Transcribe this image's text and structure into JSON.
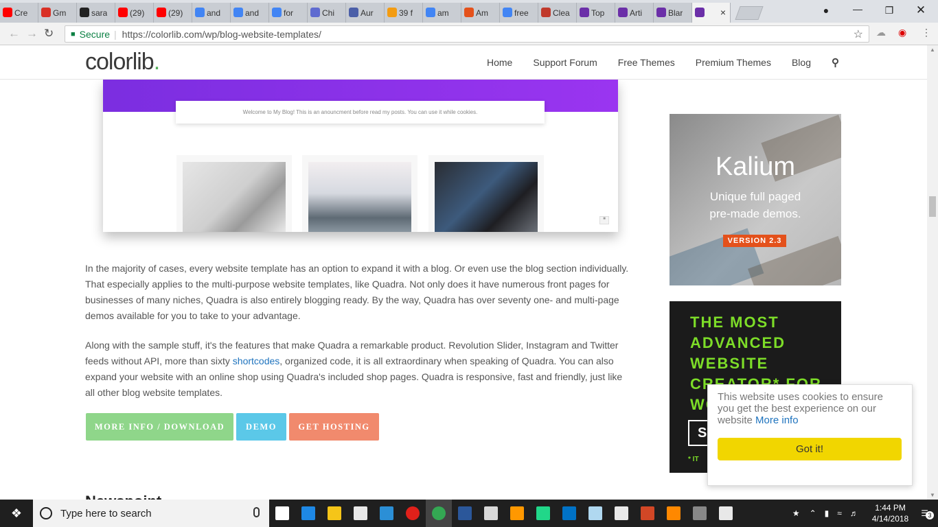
{
  "browser": {
    "tabs": [
      {
        "label": "Cre",
        "icon": "youtube-icon",
        "color": "#ff0000"
      },
      {
        "label": "Gm",
        "icon": "gmail-icon",
        "color": "#d93025"
      },
      {
        "label": "sara",
        "icon": "github-icon",
        "color": "#222222"
      },
      {
        "label": "(29)",
        "icon": "youtube-icon",
        "color": "#ff0000"
      },
      {
        "label": "(29)",
        "icon": "youtube-icon",
        "color": "#ff0000"
      },
      {
        "label": "and",
        "icon": "google-icon",
        "color": "#4285f4"
      },
      {
        "label": "and",
        "icon": "google-icon",
        "color": "#4285f4"
      },
      {
        "label": "for",
        "icon": "google-icon",
        "color": "#4285f4"
      },
      {
        "label": "Chi",
        "icon": "link-icon",
        "color": "#5f6bd0"
      },
      {
        "label": "Aur",
        "icon": "s-icon",
        "color": "#4b5fa8"
      },
      {
        "label": "39 f",
        "icon": "her-icon",
        "color": "#f39c12"
      },
      {
        "label": "am",
        "icon": "google-icon",
        "color": "#4285f4"
      },
      {
        "label": "Am",
        "icon": "fire-icon",
        "color": "#e4511b"
      },
      {
        "label": "free",
        "icon": "google-icon",
        "color": "#4285f4"
      },
      {
        "label": "Clea",
        "icon": "s-red-icon",
        "color": "#c0392b"
      },
      {
        "label": "Top",
        "icon": "colorlib-icon",
        "color": "#6b2fa8"
      },
      {
        "label": "Arti",
        "icon": "colorlib-icon",
        "color": "#6b2fa8"
      },
      {
        "label": "Blar",
        "icon": "colorlib-icon",
        "color": "#6b2fa8"
      },
      {
        "label": "",
        "icon": "colorlib-icon",
        "color": "#6b2fa8",
        "active": true
      }
    ],
    "secure_label": "Secure",
    "url": "https://colorlib.com/wp/blog-website-templates/"
  },
  "site": {
    "logo_text": "colorlib",
    "logo_dot": ".",
    "nav": [
      "Home",
      "Support Forum",
      "Free Themes",
      "Premium Themes",
      "Blog"
    ]
  },
  "article": {
    "announcement": "Welcome to My Blog! This is an anouncment before read my posts. You can use it while cookies.",
    "para1": "In the majority of cases, every website template has an option to expand it with a blog. Or even use the blog section individually. That especially applies to the multi-purpose website templates, like Quadra. Not only does it have numerous front pages for businesses of many niches, Quadra is also entirely blogging ready. By the way, Quadra has over seventy one- and multi-page demos available for you to take to your advantage.",
    "para2_a": "Along with the sample stuff, it's the features that make Quadra a remarkable product. Revolution Slider, Instagram and Twitter feeds without API, more than sixty ",
    "para2_link": "shortcodes",
    "para2_b": ", organized code, it is all extraordinary when speaking of Quadra. You can also expand your website with an online shop using Quadra's included shop pages. Quadra is responsive, fast and friendly, just like all other blog website templates.",
    "buttons": [
      {
        "label": "MORE INFO / DOWNLOAD",
        "color": "#8fd68a"
      },
      {
        "label": "DEMO",
        "color": "#5bc8e8"
      },
      {
        "label": "GET HOSTING",
        "color": "#f18a6d"
      }
    ],
    "next_heading": "Newspoint"
  },
  "ads": {
    "kalium_title": "Kalium",
    "kalium_sub1": "Unique full paged",
    "kalium_sub2": "pre-made demos.",
    "kalium_version": "VERSION 2.3",
    "ad2_head": "THE MOST\nADVANCED\nWEBSITE\nCREATOR* FOR\nWO",
    "ad2_box": "S",
    "ad2_foot": "* IT"
  },
  "cookie": {
    "message": "This website uses cookies to ensure you get the best experience on our website",
    "link": "More info",
    "button": "Got it!"
  },
  "taskbar": {
    "search_placeholder": "Type here to search",
    "time": "1:44 PM",
    "date": "4/14/2018",
    "notif_count": "3",
    "icons": [
      {
        "name": "task-view-icon",
        "color": "#ffffff"
      },
      {
        "name": "edge-icon",
        "color": "#1e88e5"
      },
      {
        "name": "file-explorer-icon",
        "color": "#f5c518"
      },
      {
        "name": "mail-icon",
        "color": "#e8e8e8"
      },
      {
        "name": "shark-icon",
        "color": "#2b8fd6"
      },
      {
        "name": "opera-icon",
        "color": "#e0201a"
      },
      {
        "name": "chrome-icon",
        "color": "#34a853"
      },
      {
        "name": "word-icon",
        "color": "#2b579a"
      },
      {
        "name": "paint-icon",
        "color": "#d8d8d8"
      },
      {
        "name": "sublime-icon",
        "color": "#ff9800"
      },
      {
        "name": "pycharm-icon",
        "color": "#21d789"
      },
      {
        "name": "outlook-icon",
        "color": "#0072c6"
      },
      {
        "name": "cube-icon",
        "color": "#b0d8f0"
      },
      {
        "name": "photos-icon",
        "color": "#e8e8e8"
      },
      {
        "name": "powerpoint-icon",
        "color": "#d24726"
      },
      {
        "name": "vlc-icon",
        "color": "#ff8800"
      },
      {
        "name": "terminal-icon",
        "color": "#888888"
      },
      {
        "name": "clapper-icon",
        "color": "#e8e8e8"
      }
    ]
  }
}
